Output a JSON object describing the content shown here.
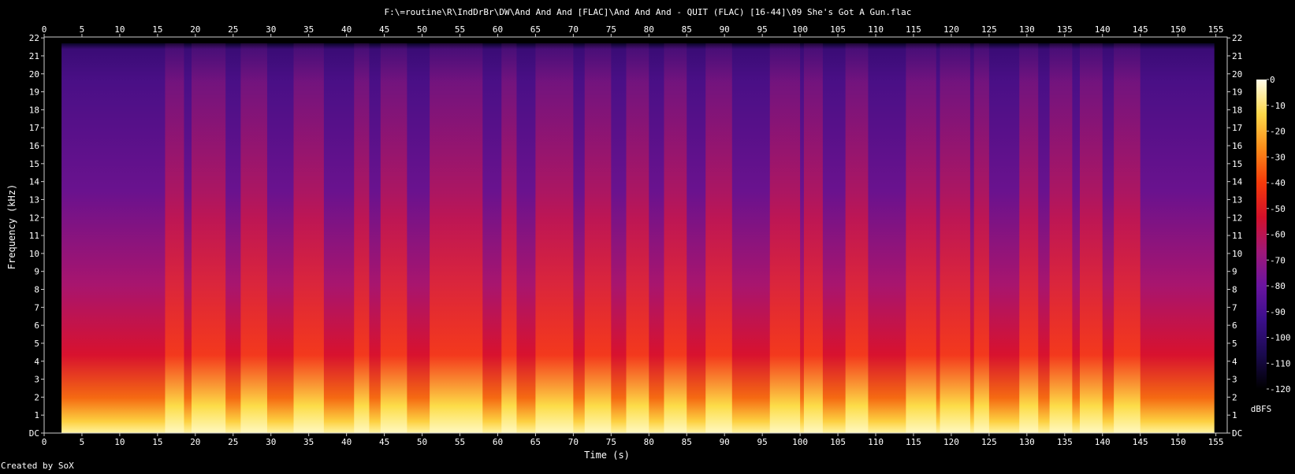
{
  "chart_data": {
    "type": "heatmap",
    "title": "F:\\=routine\\R\\IndDrBr\\DW\\And And And [FLAC]\\And And And - QUIT (FLAC) [16-44]\\09 She's Got A Gun.flac",
    "xlabel": "Time (s)",
    "ylabel": "Frequency (kHz)",
    "xlim": [
      0,
      156.5
    ],
    "ylim": [
      0,
      22.05
    ],
    "x_ticks": [
      0,
      5,
      10,
      15,
      20,
      25,
      30,
      35,
      40,
      45,
      50,
      55,
      60,
      65,
      70,
      75,
      80,
      85,
      90,
      95,
      100,
      105,
      110,
      115,
      120,
      125,
      130,
      135,
      140,
      145,
      150,
      155
    ],
    "y_ticks": [
      "DC",
      "1",
      "2",
      "3",
      "4",
      "5",
      "6",
      "7",
      "8",
      "9",
      "10",
      "11",
      "12",
      "13",
      "14",
      "15",
      "16",
      "17",
      "18",
      "19",
      "20",
      "21",
      "22"
    ],
    "colorbar": {
      "label": "dBFS",
      "range": [
        -120,
        0
      ],
      "ticks": [
        "0",
        "-10",
        "-20",
        "-30",
        "-40",
        "-50",
        "-60",
        "-70",
        "-80",
        "-90",
        "-100",
        "-110",
        "-120"
      ],
      "colors": [
        "#000000",
        "#1a0a4e",
        "#3b0f8a",
        "#6a14a0",
        "#a01878",
        "#d4102a",
        "#f53a0a",
        "#fb8c1a",
        "#fdd84a",
        "#fffbe8"
      ]
    },
    "audio_start_s": 2.3,
    "audio_end_s": 154.8,
    "high_energy_bursts_s": [
      [
        16,
        18.5
      ],
      [
        19.5,
        24
      ],
      [
        26,
        29.5
      ],
      [
        33,
        37
      ],
      [
        41,
        43
      ],
      [
        44.5,
        48
      ],
      [
        51,
        58
      ],
      [
        60.5,
        62.5
      ],
      [
        65,
        70
      ],
      [
        71.5,
        75
      ],
      [
        77,
        80
      ],
      [
        82,
        85
      ],
      [
        87.5,
        91
      ],
      [
        96,
        100
      ],
      [
        100.5,
        103
      ],
      [
        106,
        109
      ],
      [
        114,
        118
      ],
      [
        118.5,
        122.5
      ],
      [
        123,
        125
      ],
      [
        129,
        131.5
      ],
      [
        133,
        136
      ],
      [
        137,
        140
      ],
      [
        141.5,
        145
      ]
    ],
    "grid": false
  },
  "footer": {
    "credit": "Created by SoX"
  }
}
